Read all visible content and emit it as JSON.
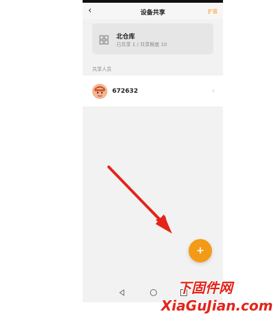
{
  "header": {
    "title": "设备共享",
    "action_label": "扩容"
  },
  "warehouse": {
    "name": "北仓库",
    "share_info": "已共享 1 / 共享额度 10",
    "icon": "grid-apps-icon"
  },
  "members_section": {
    "label": "共享人员",
    "members": [
      {
        "id": "672632",
        "avatar": "avatar"
      }
    ]
  },
  "fab": {
    "symbol": "+"
  },
  "colors": {
    "accent": "#f39a16",
    "watermark": "#e3241a"
  },
  "watermark": {
    "line1": "下固件网",
    "line2": "XiaGuJian.com"
  }
}
